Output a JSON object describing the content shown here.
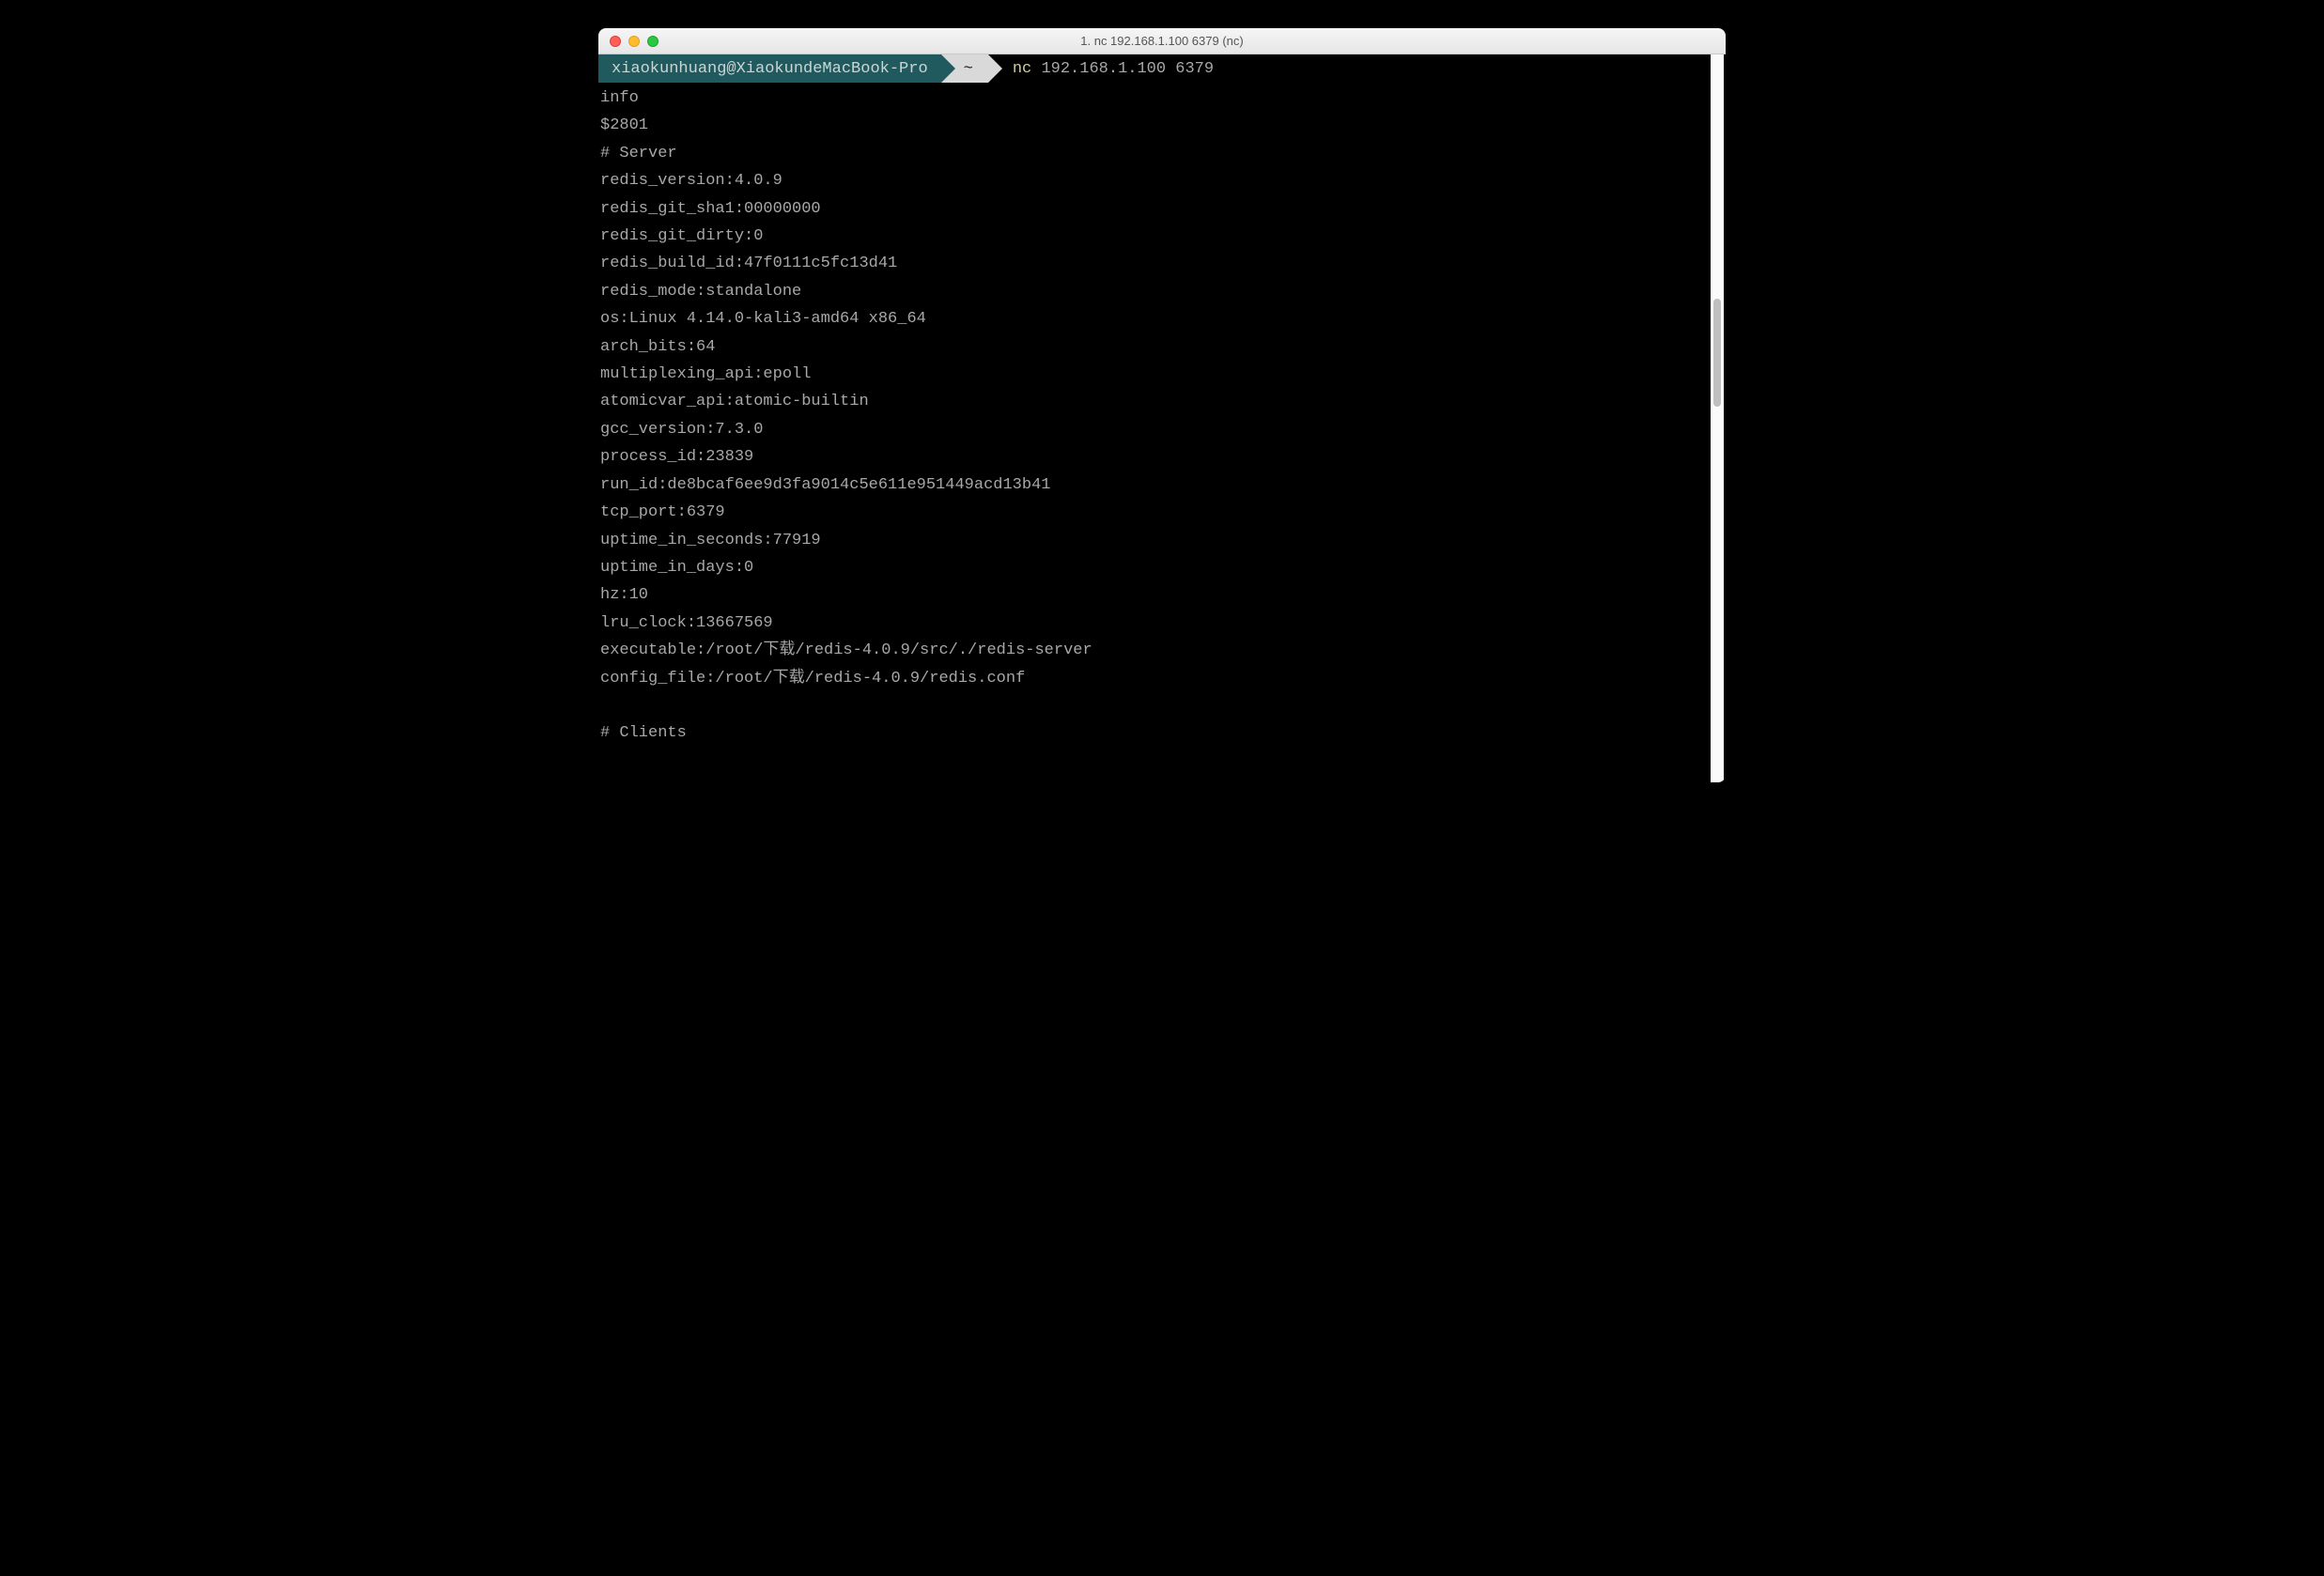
{
  "titlebar": {
    "title": "1. nc 192.168.1.100 6379 (nc)"
  },
  "prompt": {
    "user_host": "xiaokunhuang@XiaokundeMacBook-Pro",
    "path": "~",
    "cmd_name": "nc",
    "cmd_args": "192.168.1.100 6379"
  },
  "output_lines": [
    "info",
    "$2801",
    "# Server",
    "redis_version:4.0.9",
    "redis_git_sha1:00000000",
    "redis_git_dirty:0",
    "redis_build_id:47f0111c5fc13d41",
    "redis_mode:standalone",
    "os:Linux 4.14.0-kali3-amd64 x86_64",
    "arch_bits:64",
    "multiplexing_api:epoll",
    "atomicvar_api:atomic-builtin",
    "gcc_version:7.3.0",
    "process_id:23839",
    "run_id:de8bcaf6ee9d3fa9014c5e611e951449acd13b41",
    "tcp_port:6379",
    "uptime_in_seconds:77919",
    "uptime_in_days:0",
    "hz:10",
    "lru_clock:13667569",
    "executable:/root/下载/redis-4.0.9/src/./redis-server",
    "config_file:/root/下载/redis-4.0.9/redis.conf",
    "",
    "# Clients"
  ]
}
